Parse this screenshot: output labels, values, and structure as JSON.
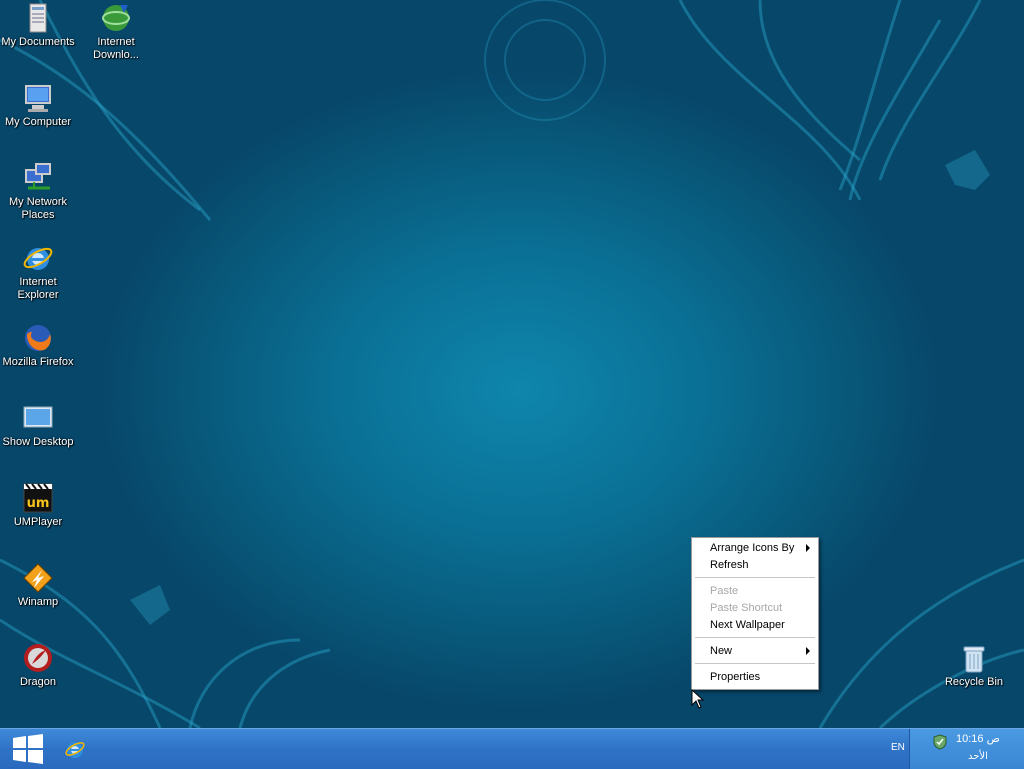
{
  "desktop": {
    "icons_left": [
      {
        "label": "My Documents",
        "icon": "my-documents-icon"
      },
      {
        "label": "My Computer",
        "icon": "my-computer-icon"
      },
      {
        "label": "My Network Places",
        "icon": "network-places-icon"
      },
      {
        "label": "Internet Explorer",
        "icon": "internet-explorer-icon"
      },
      {
        "label": "Mozilla Firefox",
        "icon": "firefox-icon"
      },
      {
        "label": "Show Desktop",
        "icon": "show-desktop-icon"
      },
      {
        "label": "UMPlayer",
        "icon": "umplayer-icon"
      },
      {
        "label": "Winamp",
        "icon": "winamp-icon"
      },
      {
        "label": "Dragon",
        "icon": "dragon-icon"
      }
    ],
    "icon_idm": {
      "label": "Internet Downlo...",
      "icon": "internet-download-manager-icon"
    },
    "icon_recycle": {
      "label": "Recycle Bin",
      "icon": "recycle-bin-icon"
    }
  },
  "context_menu": {
    "items": [
      {
        "label": "Arrange Icons By",
        "submenu": true,
        "enabled": true
      },
      {
        "label": "Refresh",
        "submenu": false,
        "enabled": true
      },
      {
        "label": "Paste",
        "submenu": false,
        "enabled": false
      },
      {
        "label": "Paste Shortcut",
        "submenu": false,
        "enabled": false
      },
      {
        "label": "Next Wallpaper",
        "submenu": false,
        "enabled": true
      },
      {
        "label": "New",
        "submenu": true,
        "enabled": true
      },
      {
        "label": "Properties",
        "submenu": false,
        "enabled": true
      }
    ]
  },
  "taskbar": {
    "start_icon": "windows-logo-icon",
    "quicklaunch_icon": "internet-explorer-icon",
    "language": "EN",
    "tray": {
      "icon": "security-shield-icon",
      "time": "10:16 ص",
      "day": "الأحد"
    }
  },
  "colors": {
    "desktop_center": "#0f86ad",
    "desktop_edge": "#07476a",
    "taskbar": "#2f73c7",
    "tray": "#3a85d3",
    "menu_disabled_text": "#a7a7a7"
  }
}
